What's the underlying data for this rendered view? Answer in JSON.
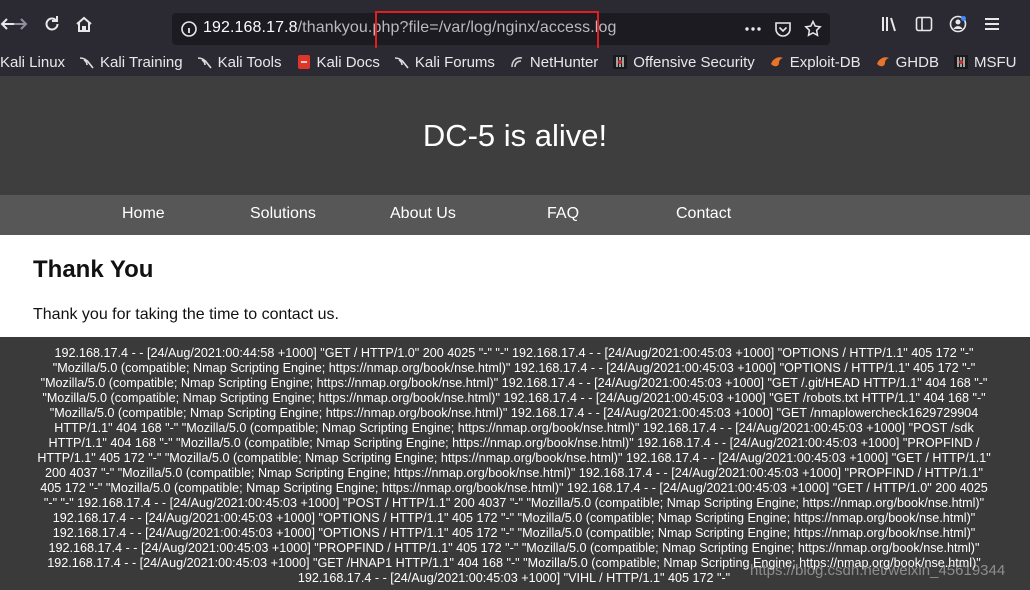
{
  "browser": {
    "url_host": "192.168.17.8",
    "url_rest": "/thankyou.php?file=/var/log/nginx/access.log",
    "bookmarks": [
      {
        "label": "Kali Linux",
        "icon": "kali-dragon-icon"
      },
      {
        "label": "Kali Training",
        "icon": "kali-dragon-icon"
      },
      {
        "label": "Kali Tools",
        "icon": "kali-dragon-icon"
      },
      {
        "label": "Kali Docs",
        "icon": "kali-docs-icon"
      },
      {
        "label": "Kali Forums",
        "icon": "kali-dragon-icon"
      },
      {
        "label": "NetHunter",
        "icon": "nethunter-icon"
      },
      {
        "label": "Offensive Security",
        "icon": "offsec-icon"
      },
      {
        "label": "Exploit-DB",
        "icon": "exploitdb-icon"
      },
      {
        "label": "GHDB",
        "icon": "exploitdb-icon"
      },
      {
        "label": "MSFU",
        "icon": "offsec-icon"
      }
    ]
  },
  "site": {
    "title": "DC-5 is alive!",
    "menu": [
      "Home",
      "Solutions",
      "About Us",
      "FAQ",
      "Contact"
    ],
    "heading": "Thank You",
    "message": "Thank you for taking the time to contact us.",
    "log": "192.168.17.4 - - [24/Aug/2021:00:44:58 +1000] \"GET / HTTP/1.0\" 200 4025 \"-\" \"-\" 192.168.17.4 - - [24/Aug/2021:00:45:03 +1000] \"OPTIONS / HTTP/1.1\" 405 172 \"-\" \"Mozilla/5.0 (compatible; Nmap Scripting Engine; https://nmap.org/book/nse.html)\" 192.168.17.4 - - [24/Aug/2021:00:45:03 +1000] \"OPTIONS / HTTP/1.1\" 405 172 \"-\" \"Mozilla/5.0 (compatible; Nmap Scripting Engine; https://nmap.org/book/nse.html)\" 192.168.17.4 - - [24/Aug/2021:00:45:03 +1000] \"GET /.git/HEAD HTTP/1.1\" 404 168 \"-\" \"Mozilla/5.0 (compatible; Nmap Scripting Engine; https://nmap.org/book/nse.html)\" 192.168.17.4 - - [24/Aug/2021:00:45:03 +1000] \"GET /robots.txt HTTP/1.1\" 404 168 \"-\" \"Mozilla/5.0 (compatible; Nmap Scripting Engine; https://nmap.org/book/nse.html)\" 192.168.17.4 - - [24/Aug/2021:00:45:03 +1000] \"GET /nmaplowercheck1629729904 HTTP/1.1\" 404 168 \"-\" \"Mozilla/5.0 (compatible; Nmap Scripting Engine; https://nmap.org/book/nse.html)\" 192.168.17.4 - - [24/Aug/2021:00:45:03 +1000] \"POST /sdk HTTP/1.1\" 404 168 \"-\" \"Mozilla/5.0 (compatible; Nmap Scripting Engine; https://nmap.org/book/nse.html)\" 192.168.17.4 - - [24/Aug/2021:00:45:03 +1000] \"PROPFIND / HTTP/1.1\" 405 172 \"-\" \"Mozilla/5.0 (compatible; Nmap Scripting Engine; https://nmap.org/book/nse.html)\" 192.168.17.4 - - [24/Aug/2021:00:45:03 +1000] \"GET / HTTP/1.1\" 200 4037 \"-\" \"Mozilla/5.0 (compatible; Nmap Scripting Engine; https://nmap.org/book/nse.html)\" 192.168.17.4 - - [24/Aug/2021:00:45:03 +1000] \"PROPFIND / HTTP/1.1\" 405 172 \"-\" \"Mozilla/5.0 (compatible; Nmap Scripting Engine; https://nmap.org/book/nse.html)\" 192.168.17.4 - - [24/Aug/2021:00:45:03 +1000] \"GET / HTTP/1.0\" 200 4025 \"-\" \"-\" 192.168.17.4 - - [24/Aug/2021:00:45:03 +1000] \"POST / HTTP/1.1\" 200 4037 \"-\" \"Mozilla/5.0 (compatible; Nmap Scripting Engine; https://nmap.org/book/nse.html)\" 192.168.17.4 - - [24/Aug/2021:00:45:03 +1000] \"OPTIONS / HTTP/1.1\" 405 172 \"-\" \"Mozilla/5.0 (compatible; Nmap Scripting Engine; https://nmap.org/book/nse.html)\" 192.168.17.4 - - [24/Aug/2021:00:45:03 +1000] \"OPTIONS / HTTP/1.1\" 405 172 \"-\" \"Mozilla/5.0 (compatible; Nmap Scripting Engine; https://nmap.org/book/nse.html)\" 192.168.17.4 - - [24/Aug/2021:00:45:03 +1000] \"PROPFIND / HTTP/1.1\" 405 172 \"-\" \"Mozilla/5.0 (compatible; Nmap Scripting Engine; https://nmap.org/book/nse.html)\" 192.168.17.4 - - [24/Aug/2021:00:45:03 +1000] \"GET /HNAP1 HTTP/1.1\" 404 168 \"-\" \"Mozilla/5.0 (compatible; Nmap Scripting Engine; https://nmap.org/book/nse.html)\" 192.168.17.4 - - [24/Aug/2021:00:45:03 +1000] \"VIHL / HTTP/1.1\" 405 172 \"-\""
  },
  "watermark": "https://blog.csdn.net/weixin_45619344",
  "colors": {
    "highlight": "#e02020",
    "hero_bg": "#3e3e3e",
    "menu_bg": "#575757"
  }
}
